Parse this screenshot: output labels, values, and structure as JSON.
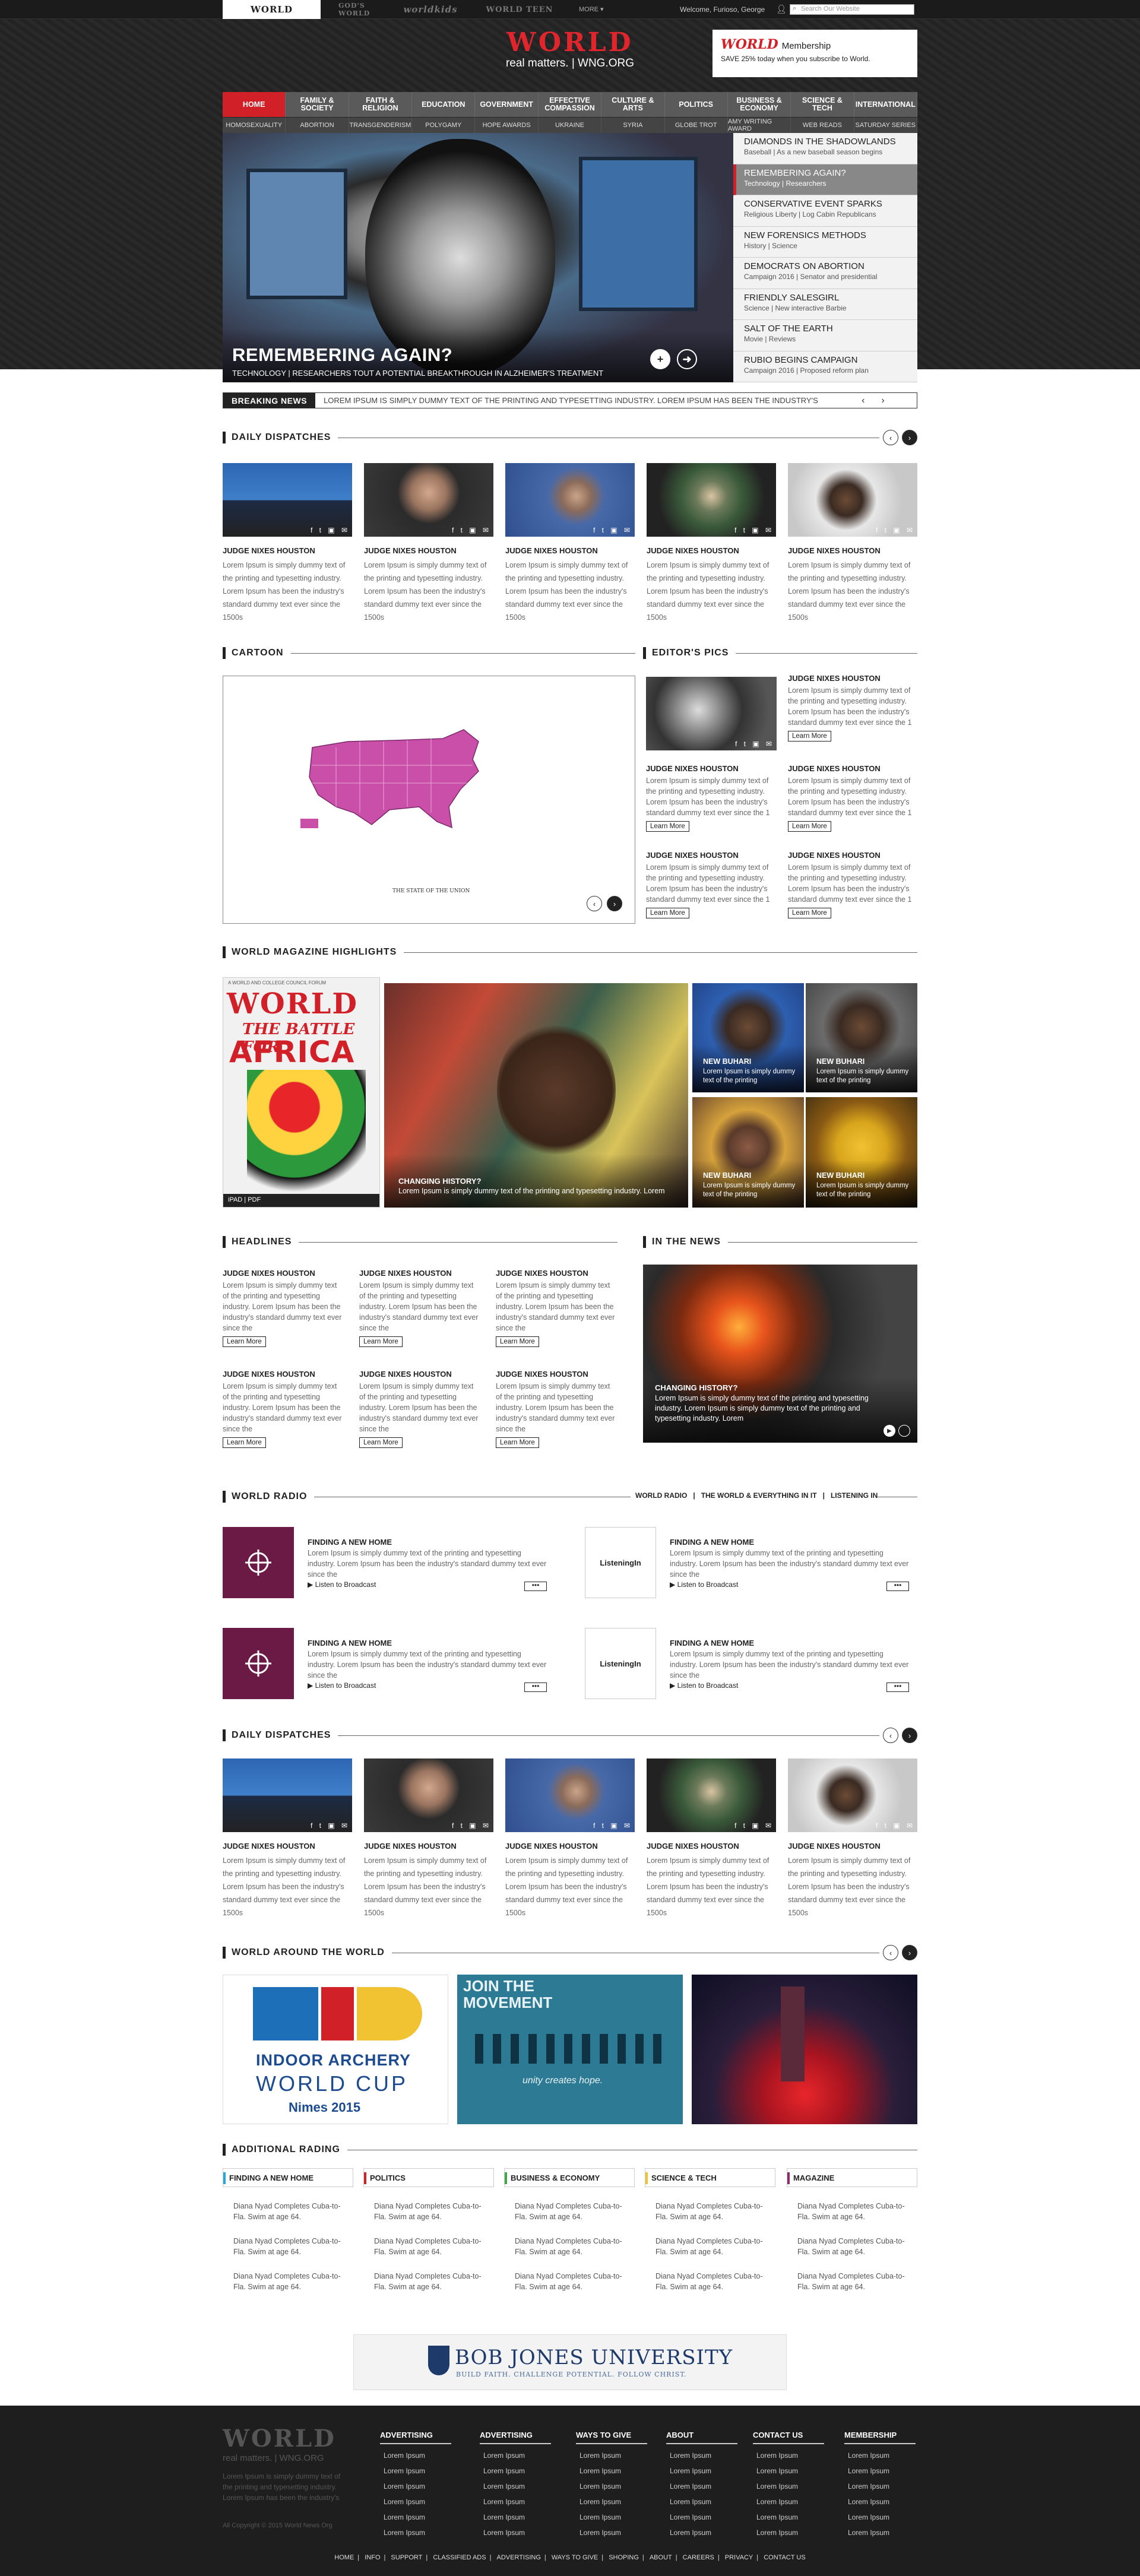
{
  "topbar": {
    "brands": [
      "WORLD",
      "GOD'S WORLD",
      "worldkids",
      "WORLD TEEN"
    ],
    "more": "MORE ▾",
    "welcome": "Welcome, Furioso, George",
    "search_placeholder": "Search Our Website"
  },
  "header": {
    "logo": "WORLD",
    "tagline": "real matters. | WNG.ORG",
    "membership_logo": "WORLD",
    "membership_label": "Membership",
    "membership_text": "SAVE 25% today when you subscribe to World."
  },
  "nav": [
    "HOME",
    "FAMILY & SOCIETY",
    "FAITH & RELIGION",
    "EDUCATION",
    "GOVERNMENT",
    "EFFECTIVE COMPASSION",
    "CULTURE & ARTS",
    "POLITICS",
    "BUSINESS & ECONOMY",
    "SCIENCE & TECH",
    "INTERNATIONAL"
  ],
  "subnav": [
    "HOMOSEXUALITY",
    "ABORTION",
    "TRANSGENDERISM",
    "POLYGAMY",
    "HOPE AWARDS",
    "UKRAINE",
    "SYRIA",
    "GLOBE TROT",
    "AMY WRITING AWARD",
    "WEB READS",
    "SATURDAY SERIES"
  ],
  "hero": {
    "title": "REMEMBERING AGAIN?",
    "subtitle": "TECHNOLOGY | RESEARCHERS TOUT A POTENTIAL BREAKTHROUGH IN ALZHEIMER'S TREATMENT"
  },
  "stories": [
    {
      "h": "DIAMONDS IN THE SHADOWLANDS",
      "d": "Baseball | As a new baseball season begins"
    },
    {
      "h": "REMEMBERING AGAIN?",
      "d": "Technology | Researchers"
    },
    {
      "h": "CONSERVATIVE EVENT SPARKS",
      "d": "Religious Liberty | Log Cabin Republicans"
    },
    {
      "h": "NEW FORENSICS METHODS",
      "d": "History | Science"
    },
    {
      "h": "DEMOCRATS ON ABORTION",
      "d": "Campaign 2016 | Senator and presidential"
    },
    {
      "h": "FRIENDLY SALESGIRL",
      "d": "Science | New interactive Barbie"
    },
    {
      "h": "SALT OF THE EARTH",
      "d": "Movie | Reviews"
    },
    {
      "h": "RUBIO BEGINS CAMPAIGN",
      "d": "Campaign 2016 | Proposed reform plan"
    }
  ],
  "breaking": {
    "label": "BREAKING NEWS",
    "text": "LOREM IPSUM IS SIMPLY DUMMY TEXT OF THE PRINTING AND TYPESETTING INDUSTRY. LOREM IPSUM HAS BEEN THE INDUSTRY'S"
  },
  "sections": {
    "daily": "DAILY DISPATCHES",
    "cartoon": "CARTOON",
    "editors": "EDITOR'S PICS",
    "magazine": "WORLD MAGAZINE HIGHLIGHTS",
    "headlines": "HEADLINES",
    "inthenews": "IN THE NEWS",
    "radio": "WORLD RADIO",
    "around": "WORLD AROUND THE WORLD",
    "additional": "ADDITIONAL RADING"
  },
  "card": {
    "title": "JUDGE NIXES HOUSTON",
    "body": "Lorem Ipsum is simply dummy text of the printing and typesetting industry. Lorem Ipsum has been the industry's standard dummy text ever since the 1500s"
  },
  "cartoon": {
    "caption": "THE STATE OF THE UNION"
  },
  "editor": {
    "title": "JUDGE NIXES HOUSTON",
    "body": "Lorem Ipsum is simply dummy text of the printing and typesetting industry. Lorem Ipsum has been the industry's standard dummy text ever since the 1",
    "learn_more": "Learn More"
  },
  "magazine": {
    "cover_top": "A WORLD AND COLLEGE COUNCIL FORUM",
    "cover_title": "WORLD",
    "cover_line1": "THE BATTLE FOR",
    "cover_line2": "AFRICA",
    "cover_foot": "iPAD | PDF",
    "feature_title": "CHANGING HISTORY?",
    "feature_body": "Lorem Ipsum is simply dummy text of the printing and typesetting industry. Lorem",
    "small_title": "NEW BUHARI",
    "small_body": "Lorem Ipsum is simply dummy text of the printing"
  },
  "headline": {
    "title": "JUDGE NIXES HOUSTON",
    "body": "Lorem Ipsum is simply dummy text of the printing and typesetting industry. Lorem Ipsum has been the industry's standard dummy text ever since the",
    "learn_more": "Learn More"
  },
  "news": {
    "title": "CHANGING HISTORY?",
    "body": "Lorem Ipsum is simply dummy text of the printing and typesetting industry. Lorem Ipsum is simply dummy text of the printing and typesetting industry. Lorem"
  },
  "radio": {
    "tabs": [
      "WORLD RADIO",
      "THE WORLD & EVERYTHING IN IT",
      "LISTENING IN"
    ],
    "title": "FINDING A NEW HOME",
    "body": "Lorem Ipsum is simply dummy text of the printing and typesetting industry. Lorem Ipsum has been the industry's standard dummy text ever since the",
    "listen": "Listen to Broadcast",
    "listening_logo": "ListeningIn"
  },
  "around": {
    "archery_line1": "INDOOR ARCHERY",
    "archery_line2": "WORLD CUP",
    "archery_line3": "Nimes 2015",
    "movement_line1": "JOIN THE",
    "movement_line2": "MOVEMENT",
    "movement_tag": "unity creates hope."
  },
  "additional": {
    "cols": [
      {
        "h": "FINDING A NEW HOME",
        "c": "#2aa7d8"
      },
      {
        "h": "POLITICS",
        "c": "#d12027"
      },
      {
        "h": "BUSINESS & ECONOMY",
        "c": "#3fa64a"
      },
      {
        "h": "SCIENCE & TECH",
        "c": "#f1c232"
      },
      {
        "h": "MAGAZINE",
        "c": "#8b2d6b"
      }
    ],
    "item": "Diana Nyad Completes Cuba-to-Fla. Swim at age 64."
  },
  "ad": {
    "name": "BOB JONES UNIVERSITY",
    "slogan": "BUILD FAITH. CHALLENGE POTENTIAL. FOLLOW CHRIST."
  },
  "footer": {
    "logo": "WORLD",
    "tagline": "real matters. | WNG.ORG",
    "desc": "Lorem Ipsum is simply dummy text of the printing and typesetting industry. Lorem Ipsum has been the industry's",
    "copyright": "All Copyright © 2015 World News Org",
    "cols": [
      "ADVERTISING",
      "ADVERTISING",
      "WAYS TO GIVE",
      "ABOUT",
      "CONTACT US",
      "MEMBERSHIP"
    ],
    "link": "Lorem Ipsum",
    "bottom": [
      "HOME",
      "INFO",
      "SUPPORT",
      "CLASSIFIED ADS",
      "ADVERTISING",
      "WAYS TO GIVE",
      "SHOPING",
      "ABOUT",
      "CAREERS",
      "PRIVACY",
      "CONTACT US"
    ]
  }
}
